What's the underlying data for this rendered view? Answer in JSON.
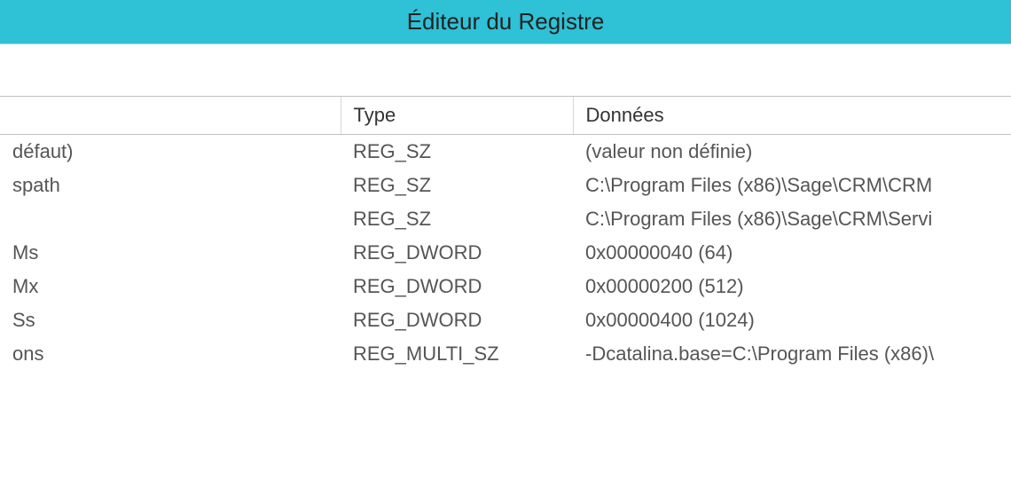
{
  "titlebar": {
    "title": "Éditeur du Registre"
  },
  "columns": {
    "name": "",
    "type": "Type",
    "data": "Données"
  },
  "rows": [
    {
      "name": "défaut)",
      "type": "REG_SZ",
      "data": "(valeur non définie)"
    },
    {
      "name": "spath",
      "type": "REG_SZ",
      "data": "C:\\Program Files (x86)\\Sage\\CRM\\CRM"
    },
    {
      "name": "",
      "type": "REG_SZ",
      "data": "C:\\Program Files (x86)\\Sage\\CRM\\Servi"
    },
    {
      "name": "Ms",
      "type": "REG_DWORD",
      "data": "0x00000040 (64)"
    },
    {
      "name": "Mx",
      "type": "REG_DWORD",
      "data": "0x00000200 (512)"
    },
    {
      "name": "Ss",
      "type": "REG_DWORD",
      "data": "0x00000400 (1024)"
    },
    {
      "name": "ons",
      "type": "REG_MULTI_SZ",
      "data": "-Dcatalina.base=C:\\Program Files (x86)\\"
    }
  ]
}
